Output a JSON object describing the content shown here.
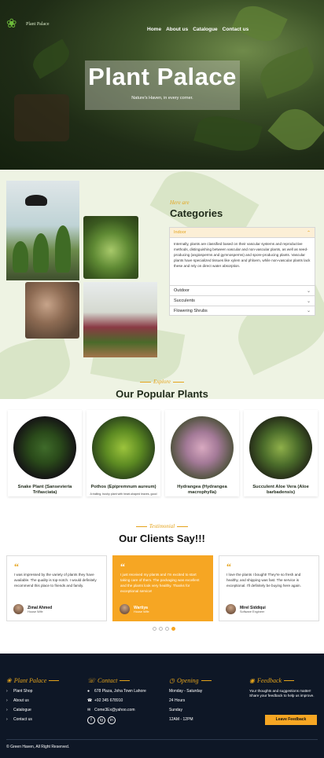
{
  "colors": {
    "accent": "#f6a623",
    "kicker": "#e4a31b",
    "footer_bg": "#0e1726",
    "section_bg": "#eef3e3"
  },
  "header": {
    "logo_text": "Plant Palace",
    "nav": [
      "Home",
      "About us",
      "Catalogue",
      "Contact us"
    ]
  },
  "hero": {
    "title": "Plant Palace",
    "subtitle": "Nature's Haven, in every corner."
  },
  "categories": {
    "kicker": "Here are",
    "title": "Categories",
    "items": [
      {
        "label": "Indoor",
        "open": true,
        "body": "Internally, plants are classified based on their vascular systems and reproductive methods, distinguishing between vascular and non-vascular plants, as well as seed-producing (angiosperms and gymnosperms) and spore-producing plants. Vascular plants have specialized tissues like xylem and phloem, while non-vascular plants lack these and rely on direct water absorption."
      },
      {
        "label": "Outdoor",
        "open": false
      },
      {
        "label": "Succulents",
        "open": false
      },
      {
        "label": "Flowering Shrubs",
        "open": false
      }
    ]
  },
  "popular": {
    "kicker": "Explore",
    "title": "Our Popular Plants",
    "items": [
      {
        "name": "Snake Plant (Sansevieria Trifasciata)",
        "desc": "",
        "icon": "snake-plant-image"
      },
      {
        "name": "Pothos (Epipremnum aureum)",
        "desc": "A trailing, bushy plant with heart-shaped leaves, good",
        "icon": "pothos-image"
      },
      {
        "name": "Hydrangea (Hydrangea macrophylla)",
        "desc": "",
        "icon": "hydrangea-image"
      },
      {
        "name": "Succulent Aloe Vera (Aloe barbadensis)",
        "desc": "",
        "icon": "aloe-image"
      }
    ]
  },
  "testimonials": {
    "kicker": "Testimonial",
    "title": "Our Clients Say!!!",
    "items": [
      {
        "text": "I was impressed by the variety of plants they have available. The quality is top-notch. I would definitely recommend this place to friends and family.",
        "name": "Zimal Ahmed",
        "role": "House Wife",
        "active": false
      },
      {
        "text": "I just received my plants and I'm excited to start taking care of them. The packaging was excellent and the plants look very healthy. Thanks for exceptional service!",
        "name": "Wartiya",
        "role": "House Wife",
        "active": true
      },
      {
        "text": "I love the plants I bought! They're so fresh and healthy, and shipping was fast. The service is exceptional. I'll definitely be buying here again.",
        "name": "Mirel Siddiqui",
        "role": "Software Engineer",
        "active": false
      }
    ],
    "dots": 4,
    "active_dot": 4
  },
  "footer": {
    "brand": {
      "title": "Plant Palace",
      "links": [
        "Plant Shop",
        "About us",
        "Catalogue",
        "Contact us"
      ]
    },
    "contact": {
      "title": "Contact",
      "address": "678 Plaza, Joha Town Lahore",
      "phone": "+92 345 678910",
      "email": "Come3Ex@yahoo.com",
      "socials": [
        "f",
        "ig",
        "in"
      ]
    },
    "opening": {
      "title": "Opening",
      "lines": [
        "Monday - Saturday",
        "24 Hours",
        "Sunday",
        "12AM - 12PM"
      ]
    },
    "feedback": {
      "title": "Feedback",
      "text": "Your thoughts and suggestions matter! Share your feedback to help us improve.",
      "button": "Leave Feedback"
    },
    "copyright": "© Green Haven, All Right Reserved."
  }
}
